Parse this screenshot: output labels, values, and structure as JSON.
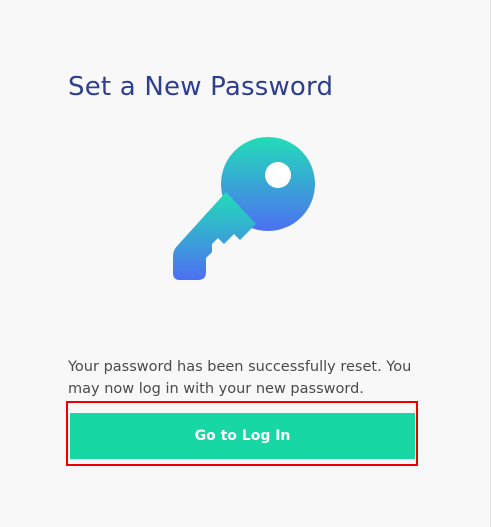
{
  "header": {
    "title": "Set a New Password"
  },
  "illustration": {
    "icon": "key-icon",
    "gradient_top": "#22d8b8",
    "gradient_bottom": "#4a74f0"
  },
  "message": {
    "text": "Your password has been successfully reset. You may now log in with your new password."
  },
  "actions": {
    "login_label": "Go to Log In",
    "login_color": "#17d8a4",
    "highlight_color": "#ee0000"
  }
}
